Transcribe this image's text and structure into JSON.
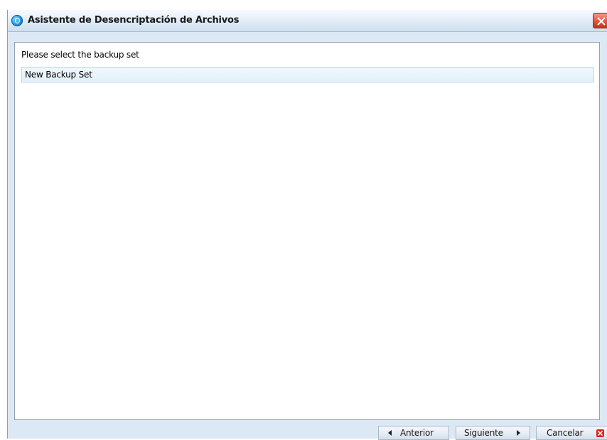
{
  "window": {
    "title": "Asistente de Desencriptación de Archivos"
  },
  "content": {
    "prompt": "Please select the backup set",
    "backup_sets": [
      {
        "label": "New Backup Set",
        "selected": true
      }
    ]
  },
  "buttons": {
    "back_label": "Anterior",
    "next_label": "Siguiente",
    "cancel_label": "Cancelar"
  },
  "icons": {
    "app": "app-logo-icon",
    "close": "close-icon",
    "back": "arrow-left-icon",
    "next": "arrow-right-icon",
    "cancel": "cancel-x-icon"
  },
  "colors": {
    "titlebar": "#dce8f3",
    "close": "#e4553f",
    "selection": "#e3f0fa",
    "cancel_icon": "#d9261c"
  }
}
